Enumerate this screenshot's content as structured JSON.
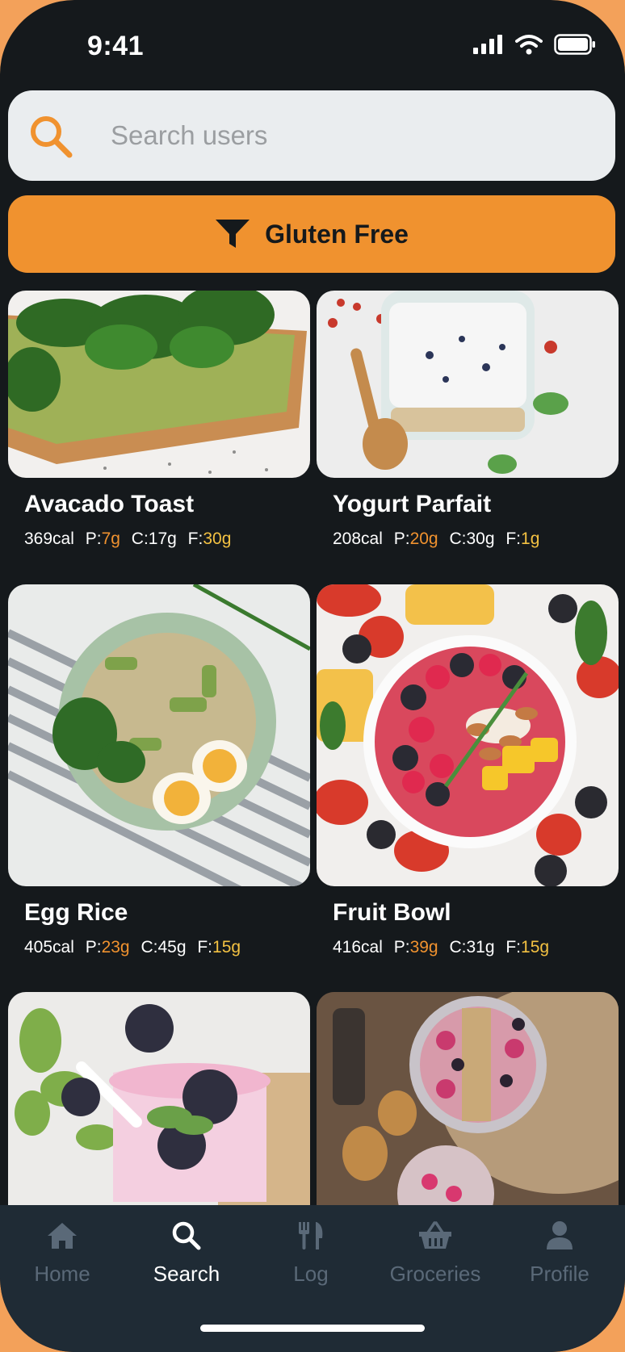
{
  "status_bar": {
    "time": "9:41"
  },
  "search": {
    "placeholder": "Search users",
    "accent": "#f0922f"
  },
  "filter": {
    "label": "Gluten Free",
    "color": "#f0922f"
  },
  "recipes": [
    {
      "name": "Avacado Toast",
      "cal": "369cal",
      "p": "7g",
      "c": "17g",
      "f": "30g"
    },
    {
      "name": "Yogurt Parfait",
      "cal": "208cal",
      "p": "20g",
      "c": "30g",
      "f": "1g"
    },
    {
      "name": "Egg Rice",
      "cal": "405cal",
      "p": "23g",
      "c": "45g",
      "f": "15g"
    },
    {
      "name": "Fruit Bowl",
      "cal": "416cal",
      "p": "39g",
      "c": "31g",
      "f": "15g"
    }
  ],
  "macro_labels": {
    "p": "P:",
    "c": "C:",
    "f": "F:"
  },
  "nav": [
    {
      "label": "Home",
      "icon": "home-icon",
      "active": false
    },
    {
      "label": "Search",
      "icon": "search-icon",
      "active": true
    },
    {
      "label": "Log",
      "icon": "utensils-icon",
      "active": false
    },
    {
      "label": "Groceries",
      "icon": "basket-icon",
      "active": false
    },
    {
      "label": "Profile",
      "icon": "person-icon",
      "active": false
    }
  ]
}
